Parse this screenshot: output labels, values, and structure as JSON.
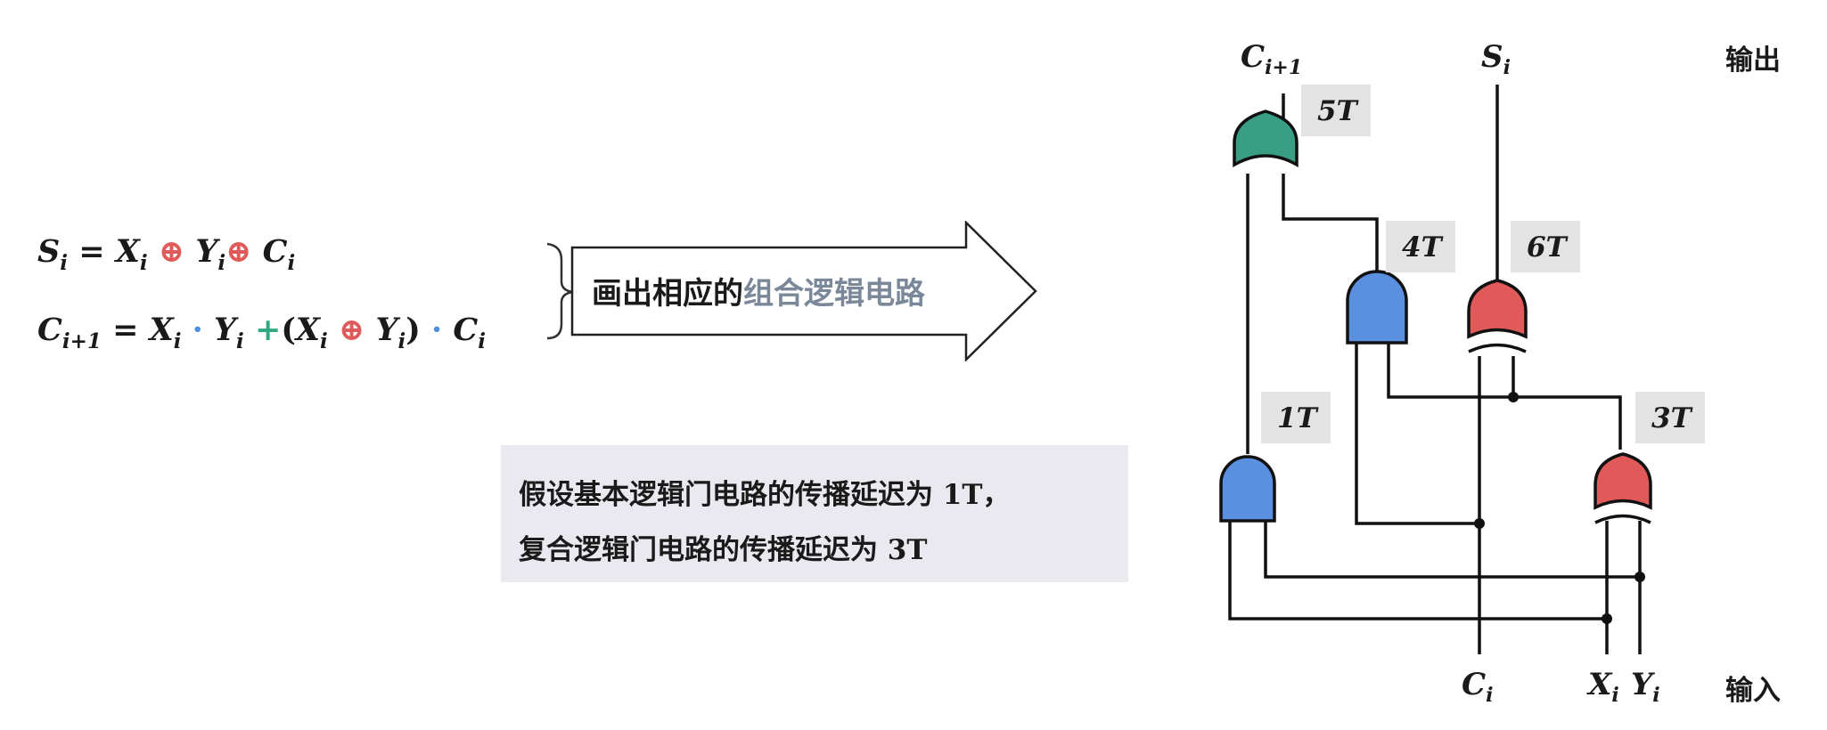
{
  "equations": {
    "sum": {
      "lhs": "S",
      "lhs_sub": "i",
      "eq": "=",
      "a": "X",
      "a_sub": "i",
      "op1": "⊕",
      "b": "Y",
      "b_sub": "i",
      "op2": "⊕",
      "c": "C",
      "c_sub": "i"
    },
    "carry": {
      "lhs": "C",
      "lhs_sub": "i+1",
      "eq": "=",
      "a": "X",
      "a_sub": "i",
      "dot1": "·",
      "b": "Y",
      "b_sub": "i",
      "plus": "+",
      "lp": "(",
      "c": "X",
      "c_sub": "i",
      "xor": "⊕",
      "d": "Y",
      "d_sub": "i",
      "rp": ")",
      "dot2": "·",
      "e": "C",
      "e_sub": "i"
    }
  },
  "arrow": {
    "text_plain": "画出相应的",
    "text_highlight": "组合逻辑电路"
  },
  "note": {
    "line1_text": "假设基本逻辑门电路的传播延迟为",
    "line1_value": "1T",
    "line1_comma": "，",
    "line2_text": "复合逻辑门电路的传播延迟为",
    "line2_value": "3T"
  },
  "circuit": {
    "output_tag": "输出",
    "input_tag": "输入",
    "out_carry": {
      "base": "C",
      "sub": "i+1"
    },
    "out_sum": {
      "base": "S",
      "sub": "i"
    },
    "in_c": {
      "base": "C",
      "sub": "i"
    },
    "in_x": {
      "base": "X",
      "sub": "i"
    },
    "in_y": {
      "base": "Y",
      "sub": "i"
    },
    "delays": {
      "or_gate": "5T",
      "and_top": "4T",
      "xor_top": "6T",
      "and_bottom": "1T",
      "xor_bottom": "3T"
    },
    "colors": {
      "or_gate": "#3a9e84",
      "and_gate": "#5b8fe0",
      "xor_gate": "#e05a5a",
      "label_bg": "#e3e3e3"
    }
  }
}
